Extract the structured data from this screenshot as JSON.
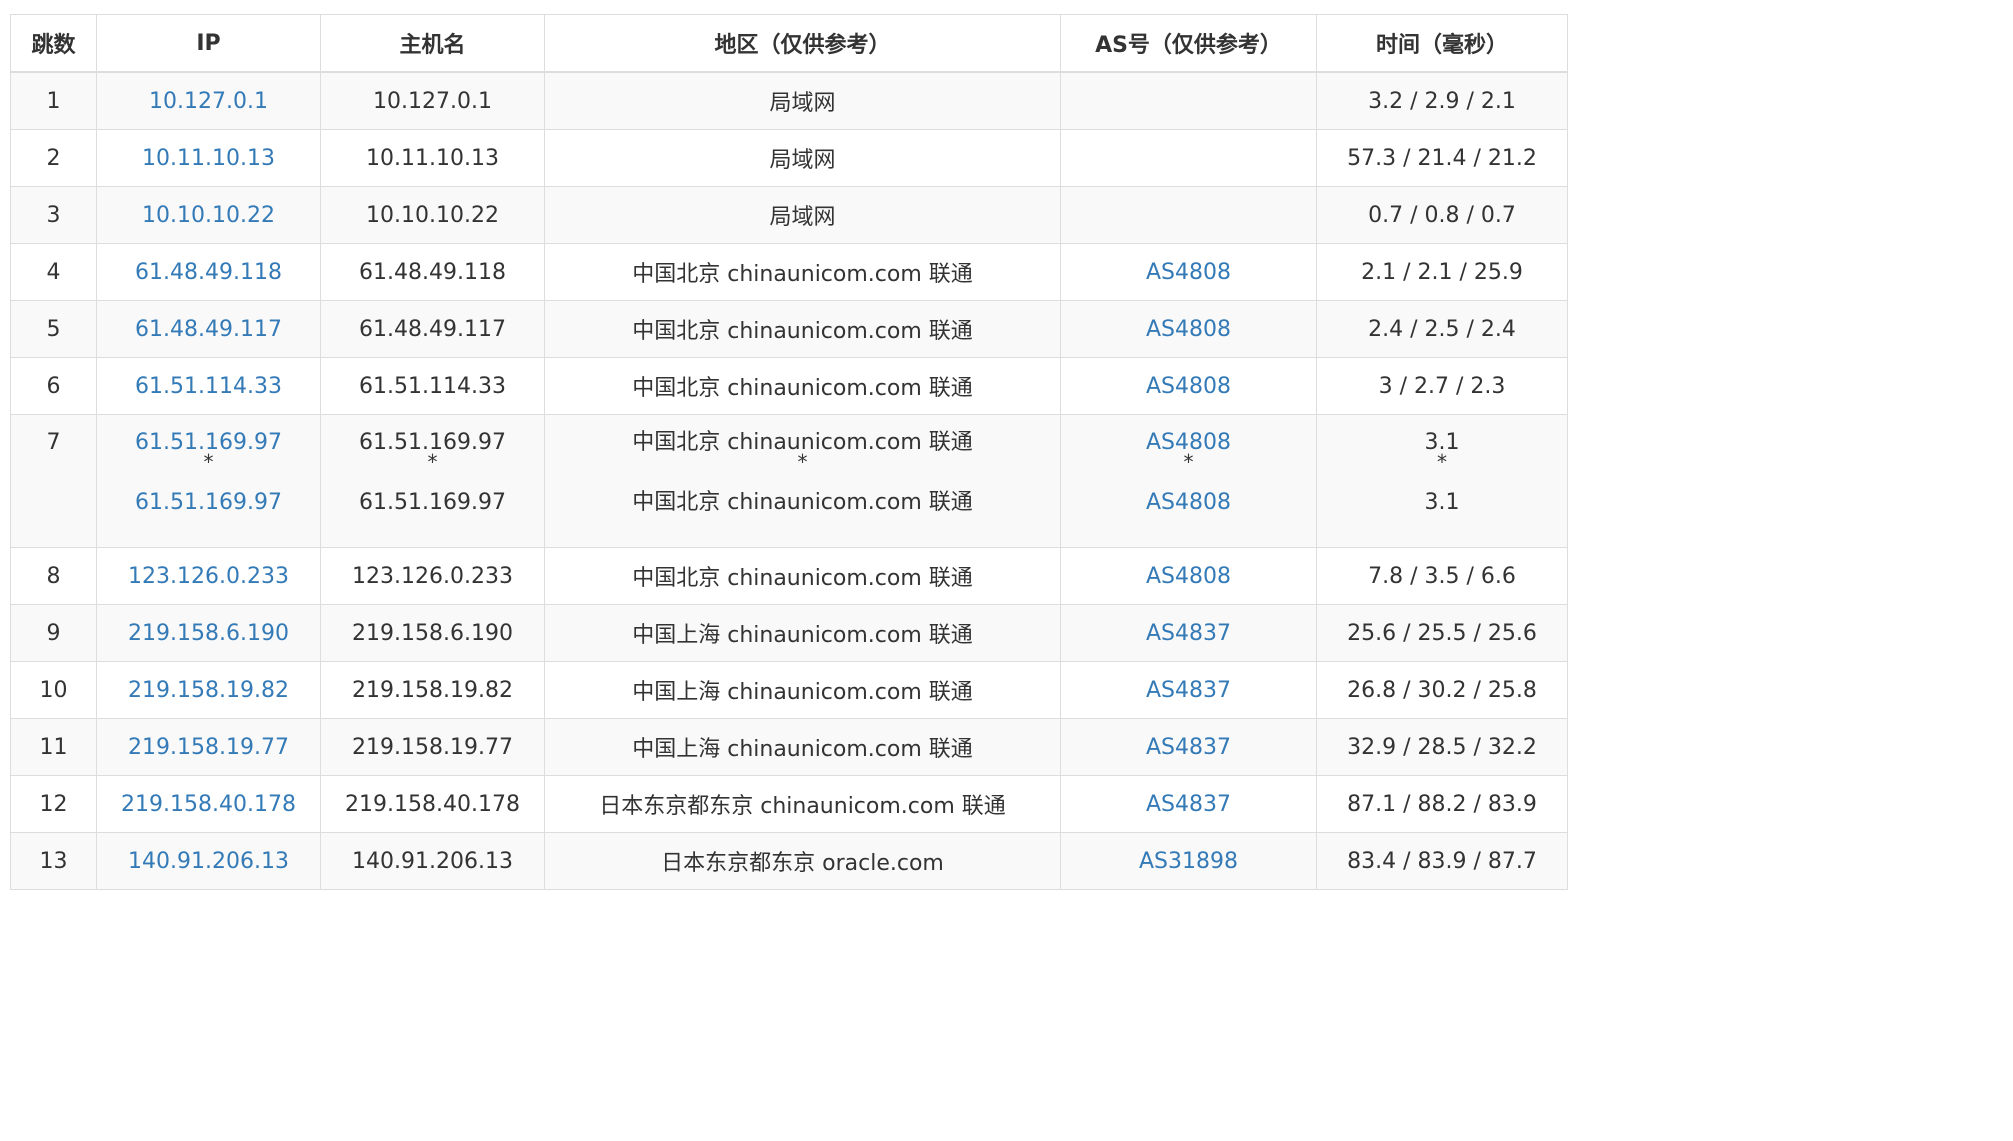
{
  "headers": [
    "跳数",
    "IP",
    "主机名",
    "地区（仅供参考）",
    "AS号（仅供参考）",
    "时间（毫秒）"
  ],
  "rows": [
    {
      "hop": "1",
      "ip": "10.127.0.1",
      "host": "10.127.0.1",
      "region": "局域网",
      "as": "",
      "time": "3.2 / 2.9 / 2.1"
    },
    {
      "hop": "2",
      "ip": "10.11.10.13",
      "host": "10.11.10.13",
      "region": "局域网",
      "as": "",
      "time": "57.3 / 21.4 / 21.2"
    },
    {
      "hop": "3",
      "ip": "10.10.10.22",
      "host": "10.10.10.22",
      "region": "局域网",
      "as": "",
      "time": "0.7 / 0.8 / 0.7"
    },
    {
      "hop": "4",
      "ip": "61.48.49.118",
      "host": "61.48.49.118",
      "region": "中国北京 chinaunicom.com 联通",
      "as": "AS4808",
      "time": "2.1 / 2.1 / 25.9"
    },
    {
      "hop": "5",
      "ip": "61.48.49.117",
      "host": "61.48.49.117",
      "region": "中国北京 chinaunicom.com 联通",
      "as": "AS4808",
      "time": "2.4 / 2.5 / 2.4"
    },
    {
      "hop": "6",
      "ip": "61.51.114.33",
      "host": "61.51.114.33",
      "region": "中国北京 chinaunicom.com 联通",
      "as": "AS4808",
      "time": "3 / 2.7 / 2.3"
    },
    {
      "hop": "7",
      "multi": true,
      "ip": "61.51.169.97",
      "host": "61.51.169.97",
      "region": "中国北京 chinaunicom.com 联通",
      "as": "AS4808",
      "time": "3.1",
      "star": "*",
      "ip2": "61.51.169.97",
      "host2": "61.51.169.97",
      "region2": "中国北京 chinaunicom.com 联通",
      "as2": "AS4808",
      "time2": "3.1"
    },
    {
      "hop": "8",
      "ip": "123.126.0.233",
      "host": "123.126.0.233",
      "region": "中国北京 chinaunicom.com 联通",
      "as": "AS4808",
      "time": "7.8 / 3.5 / 6.6"
    },
    {
      "hop": "9",
      "ip": "219.158.6.190",
      "host": "219.158.6.190",
      "region": "中国上海 chinaunicom.com 联通",
      "as": "AS4837",
      "time": "25.6 / 25.5 / 25.6"
    },
    {
      "hop": "10",
      "ip": "219.158.19.82",
      "host": "219.158.19.82",
      "region": "中国上海 chinaunicom.com 联通",
      "as": "AS4837",
      "time": "26.8 / 30.2 / 25.8"
    },
    {
      "hop": "11",
      "ip": "219.158.19.77",
      "host": "219.158.19.77",
      "region": "中国上海 chinaunicom.com 联通",
      "as": "AS4837",
      "time": "32.9 / 28.5 / 32.2"
    },
    {
      "hop": "12",
      "ip": "219.158.40.178",
      "host": "219.158.40.178",
      "region": "日本东京都东京 chinaunicom.com 联通",
      "as": "AS4837",
      "time": "87.1 / 88.2 / 83.9"
    },
    {
      "hop": "13",
      "ip": "140.91.206.13",
      "host": "140.91.206.13",
      "region": "日本东京都东京 oracle.com",
      "as": "AS31898",
      "time": "83.4 / 83.9 / 87.7"
    }
  ],
  "colors": {
    "link": "#337ab7",
    "text": "#333333",
    "border": "#dddddd",
    "stripe": "#f9f9f9"
  }
}
